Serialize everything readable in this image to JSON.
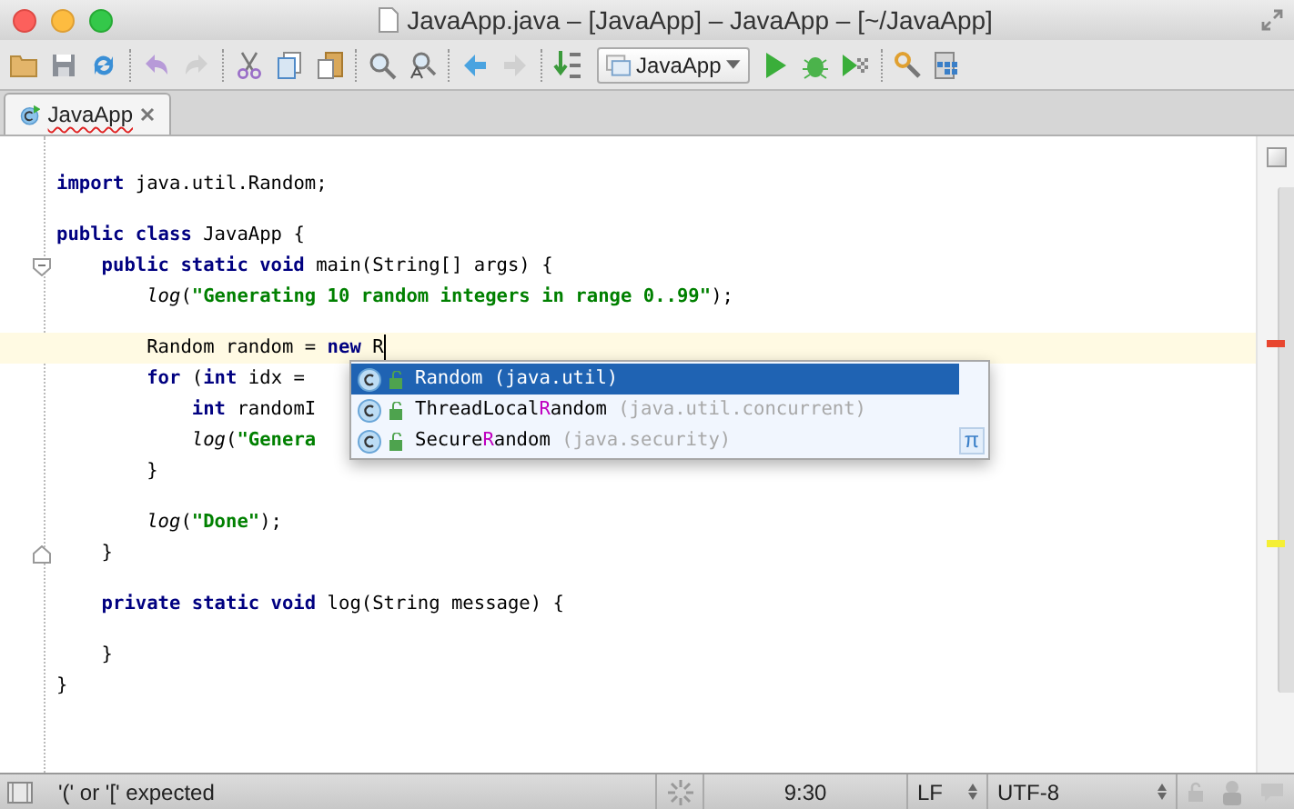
{
  "window": {
    "title": "JavaApp.java – [JavaApp] – JavaApp – [~/JavaApp]"
  },
  "toolbar": {
    "run_configuration": "JavaApp"
  },
  "tabs": [
    {
      "label": "JavaApp",
      "selected": true,
      "error": true
    }
  ],
  "editor": {
    "lines": [
      {
        "kind": "code",
        "segments": [
          {
            "text": "import",
            "kind": "keyword"
          },
          {
            "text": " java.util.Random;",
            "kind": "plain"
          }
        ]
      },
      {
        "kind": "blank"
      },
      {
        "kind": "code",
        "segments": [
          {
            "text": "public class",
            "kind": "keyword"
          },
          {
            "text": " JavaApp {",
            "kind": "plain"
          }
        ]
      },
      {
        "kind": "fold_start",
        "segments": [
          {
            "text": "    public static void",
            "kind": "keyword"
          },
          {
            "text": " main(String[] args) {",
            "kind": "plain"
          }
        ]
      },
      {
        "kind": "code",
        "segments": [
          {
            "text": "        log",
            "kind": "call"
          },
          {
            "text": "(",
            "kind": "plain"
          },
          {
            "text": "\"Generating 10 random integers in range 0..99\"",
            "kind": "string"
          },
          {
            "text": ");",
            "kind": "plain"
          }
        ]
      },
      {
        "kind": "blank"
      },
      {
        "kind": "code",
        "segments": [
          {
            "text": "        Random random = ",
            "kind": "plain"
          },
          {
            "text": "new",
            "kind": "keyword"
          },
          {
            "text": " R",
            "kind": "plain"
          }
        ],
        "current": true
      },
      {
        "kind": "code",
        "segments": [
          {
            "text": "        for",
            "kind": "keyword"
          },
          {
            "text": " (",
            "kind": "plain"
          },
          {
            "text": "int",
            "kind": "keyword"
          },
          {
            "text": " idx =",
            "kind": "plain"
          }
        ]
      },
      {
        "kind": "code",
        "segments": [
          {
            "text": "            int",
            "kind": "keyword"
          },
          {
            "text": " randomI",
            "kind": "plain"
          }
        ]
      },
      {
        "kind": "code",
        "segments": [
          {
            "text": "            log",
            "kind": "call"
          },
          {
            "text": "(",
            "kind": "plain"
          },
          {
            "text": "\"Genera",
            "kind": "string"
          }
        ]
      },
      {
        "kind": "code",
        "segments": [
          {
            "text": "        }",
            "kind": "plain"
          }
        ]
      },
      {
        "kind": "blank"
      },
      {
        "kind": "code",
        "segments": [
          {
            "text": "        log",
            "kind": "call"
          },
          {
            "text": "(",
            "kind": "plain"
          },
          {
            "text": "\"Done\"",
            "kind": "string"
          },
          {
            "text": ");",
            "kind": "plain"
          }
        ]
      },
      {
        "kind": "fold_end",
        "segments": [
          {
            "text": "    }",
            "kind": "plain"
          }
        ]
      },
      {
        "kind": "blank"
      },
      {
        "kind": "code",
        "segments": [
          {
            "text": "    private static void",
            "kind": "keyword"
          },
          {
            "text": " log(String message) {",
            "kind": "plain"
          }
        ]
      },
      {
        "kind": "blank"
      },
      {
        "kind": "code",
        "segments": [
          {
            "text": "    }",
            "kind": "plain"
          }
        ]
      },
      {
        "kind": "code",
        "segments": [
          {
            "text": "}",
            "kind": "plain"
          }
        ]
      }
    ]
  },
  "completion": {
    "items": [
      {
        "parts": [
          {
            "text": "Random",
            "match": false
          }
        ],
        "package": "(java.util)",
        "selected": true
      },
      {
        "parts": [
          {
            "text": "ThreadLocal",
            "match": false
          },
          {
            "text": "R",
            "match": true
          },
          {
            "text": "andom",
            "match": false
          }
        ],
        "package": "(java.util.concurrent)",
        "selected": false
      },
      {
        "parts": [
          {
            "text": "Secure",
            "match": false
          },
          {
            "text": "R",
            "match": true
          },
          {
            "text": "andom",
            "match": false
          }
        ],
        "package": "(java.security)",
        "selected": false
      }
    ],
    "footer_symbol": "π"
  },
  "status_bar": {
    "message": "'(' or '[' expected",
    "position": "9:30",
    "line_separator": "LF",
    "encoding": "UTF-8"
  }
}
